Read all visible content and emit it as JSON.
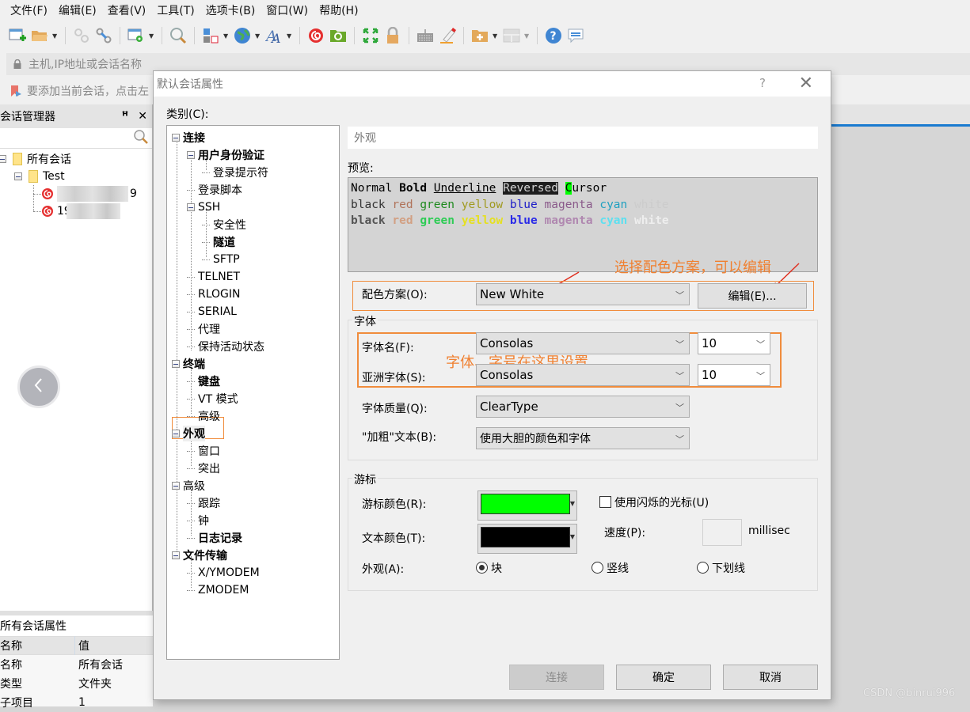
{
  "menu": [
    "文件(F)",
    "编辑(E)",
    "查看(V)",
    "工具(T)",
    "选项卡(B)",
    "窗口(W)",
    "帮助(H)"
  ],
  "toolbar_icons": [
    "new-session-icon",
    "open-folder-icon",
    "reconnect-icon",
    "disconnect-icon",
    "session-settings-icon",
    "find-icon",
    "layout-icon",
    "globe-icon",
    "font-icon",
    "xshell-icon",
    "xftp-icon",
    "fullscreen-icon",
    "lock-icon",
    "keyboard-icon",
    "highlight-icon",
    "new-folder-icon",
    "split-layout-icon",
    "help-icon",
    "chat-icon"
  ],
  "address_bar": {
    "placeholder": "主机,IP地址或会话名称"
  },
  "hint_bar": {
    "text": "要添加当前会话，点击左"
  },
  "session_manager": {
    "title": "会话管理器",
    "tree": {
      "root": "所有会话",
      "folder": "Test",
      "sessions": [
        "9",
        "19"
      ]
    }
  },
  "properties": {
    "title": "所有会话属性",
    "headers": [
      "名称",
      "值"
    ],
    "rows": [
      {
        "name": "名称",
        "value": "所有会话"
      },
      {
        "name": "类型",
        "value": "文件夹"
      },
      {
        "name": "子项目",
        "value": "1"
      }
    ]
  },
  "dialog": {
    "title": "默认会话属性",
    "help": "?",
    "category_label": "类别(C):",
    "categories": [
      {
        "label": "连接",
        "bold": true
      },
      {
        "label": "用户身份验证",
        "bold": true
      },
      {
        "label": "登录提示符",
        "bold": false
      },
      {
        "label": "登录脚本",
        "bold": false
      },
      {
        "label": "SSH",
        "bold": false
      },
      {
        "label": "安全性",
        "bold": false
      },
      {
        "label": "隧道",
        "bold": true
      },
      {
        "label": "SFTP",
        "bold": false
      },
      {
        "label": "TELNET",
        "bold": false
      },
      {
        "label": "RLOGIN",
        "bold": false
      },
      {
        "label": "SERIAL",
        "bold": false
      },
      {
        "label": "代理",
        "bold": false
      },
      {
        "label": "保持活动状态",
        "bold": false
      },
      {
        "label": "终端",
        "bold": true
      },
      {
        "label": "键盘",
        "bold": true
      },
      {
        "label": "VT 模式",
        "bold": false
      },
      {
        "label": "高级",
        "bold": false
      },
      {
        "label": "外观",
        "bold": true,
        "selected": true
      },
      {
        "label": "窗口",
        "bold": false
      },
      {
        "label": "突出",
        "bold": false
      },
      {
        "label": "高级",
        "bold": false
      },
      {
        "label": "跟踪",
        "bold": false
      },
      {
        "label": "钟",
        "bold": false
      },
      {
        "label": "日志记录",
        "bold": true
      },
      {
        "label": "文件传输",
        "bold": true
      },
      {
        "label": "X/YMODEM",
        "bold": false
      },
      {
        "label": "ZMODEM",
        "bold": false
      }
    ],
    "section_title": "外观",
    "preview_label": "预览:",
    "preview": {
      "line1": {
        "normal": "Normal",
        "bold": "Bold",
        "underline": "Underline",
        "reversed": "Reversed",
        "cursor_char": "C",
        "cursor_rest": "ursor"
      },
      "colors": [
        {
          "name": "black",
          "normal": "#333333",
          "bold": "#555555"
        },
        {
          "name": "red",
          "normal": "#b0735a",
          "bold": "#d2a083"
        },
        {
          "name": "green",
          "normal": "#1e8a1e",
          "bold": "#2ecc55"
        },
        {
          "name": "yellow",
          "normal": "#a09a20",
          "bold": "#e5e020"
        },
        {
          "name": "blue",
          "normal": "#2020c8",
          "bold": "#2a2ae8"
        },
        {
          "name": "magenta",
          "normal": "#8a5a8a",
          "bold": "#b088b0"
        },
        {
          "name": "cyan",
          "normal": "#20a0c0",
          "bold": "#5ee0f0"
        },
        {
          "name": "white",
          "normal": "#cccccc",
          "bold": "#eeeeee"
        }
      ]
    },
    "annotation_scheme": "选择配色方案，可以编辑",
    "annotation_font": "字体、字号在这里设置",
    "color_scheme_label": "配色方案(O):",
    "color_scheme_value": "New White",
    "edit_button": "编辑(E)...",
    "font_group": "字体",
    "font_name_label": "字体名(F):",
    "font_name_value": "Consolas",
    "font_size_value": "10",
    "asian_font_label": "亚洲字体(S):",
    "asian_font_value": "Consolas",
    "asian_font_size_value": "10",
    "font_quality_label": "字体质量(Q):",
    "font_quality_value": "ClearType",
    "bold_text_label": "\"加粗\"文本(B):",
    "bold_text_value": "使用大胆的颜色和字体",
    "cursor_group": "游标",
    "cursor_color_label": "游标颜色(R):",
    "cursor_color": "#00ff00",
    "text_color_label": "文本颜色(T):",
    "text_color": "#000000",
    "blink_label": "使用闪烁的光标(U)",
    "blink_checked": false,
    "speed_label": "速度(P):",
    "speed_value": "",
    "speed_unit": "millisec",
    "appearance_label": "外观(A):",
    "appearance_options": [
      {
        "label": "块",
        "selected": true
      },
      {
        "label": "竖线",
        "selected": false
      },
      {
        "label": "下划线",
        "selected": false
      }
    ],
    "buttons": {
      "connect": "连接",
      "ok": "确定",
      "cancel": "取消"
    }
  },
  "watermark": "CSDN @binrui996"
}
